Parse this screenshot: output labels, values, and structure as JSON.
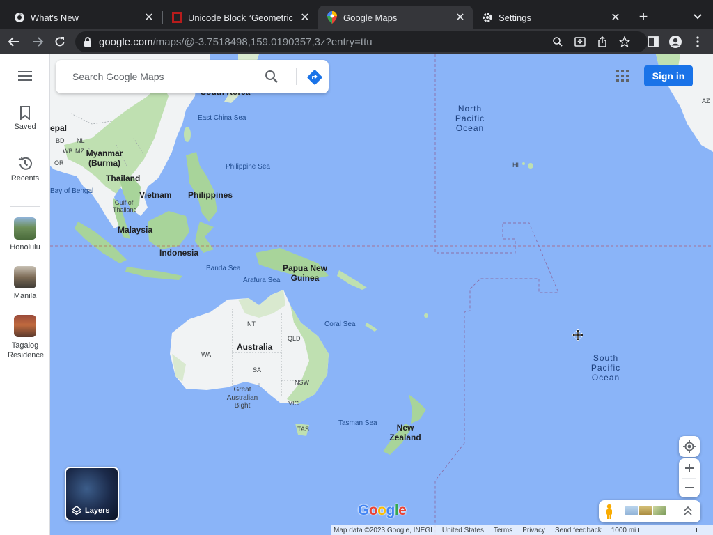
{
  "browser": {
    "tabs": [
      {
        "title": "What's New",
        "icon": "chrome-icon",
        "active": false
      },
      {
        "title": "Unicode Block “Geometric S",
        "icon": "unicode-site-icon",
        "active": false
      },
      {
        "title": "Google Maps",
        "icon": "google-maps-icon",
        "active": true
      },
      {
        "title": "Settings",
        "icon": "gear-icon",
        "active": false
      }
    ],
    "url_host": "google.com",
    "url_path": "/maps/@-3.7518498,159.0190357,3z?entry=ttu"
  },
  "rail": {
    "menu_icon": "hamburger-icon",
    "saved_label": "Saved",
    "recents_label": "Recents",
    "recent_places": [
      {
        "label": "Honolulu"
      },
      {
        "label": "Manila"
      },
      {
        "label": "Tagalog Residence"
      }
    ]
  },
  "map": {
    "search_placeholder": "Search Google Maps",
    "sign_in_label": "Sign in",
    "layers_label": "Layers",
    "oceans": {
      "north_pacific": "North Pacific Ocean",
      "south_pacific": "South Pacific Ocean"
    },
    "seas": {
      "east_china": "East China Sea",
      "philippine": "Philippine Sea",
      "bay_of_bengal": "Bay of Bengal",
      "banda": "Banda Sea",
      "arafura": "Arafura Sea",
      "coral": "Coral Sea",
      "tasman": "Tasman Sea",
      "gulf_thailand": "Gulf of Thailand",
      "great_australian_bight": "Great Australian Bight"
    },
    "countries": {
      "south_korea": "South Korea",
      "nepal": "epal",
      "myanmar": "Myanmar (Burma)",
      "thailand": "Thailand",
      "vietnam": "Vietnam",
      "philippines": "Philippines",
      "malaysia": "Malaysia",
      "indonesia": "Indonesia",
      "png": "Papua New Guinea",
      "australia": "Australia",
      "new_zealand": "New Zealand"
    },
    "small_labels": {
      "bd": "BD",
      "wb": "WB",
      "nl": "NL",
      "mz": "MZ",
      "or": "OR",
      "hi": "HI",
      "nt": "NT",
      "qld": "QLD",
      "wa": "WA",
      "sa": "SA",
      "nsw": "NSW",
      "vic": "VIC",
      "tas": "TAS",
      "az": "AZ"
    },
    "attribution": {
      "map_data": "Map data ©2023 Google, INEGI",
      "region": "United States",
      "terms": "Terms",
      "privacy": "Privacy",
      "feedback": "Send feedback",
      "scale": "1000 mi"
    },
    "logo_letters": [
      "G",
      "o",
      "o",
      "g",
      "l",
      "e"
    ]
  }
}
